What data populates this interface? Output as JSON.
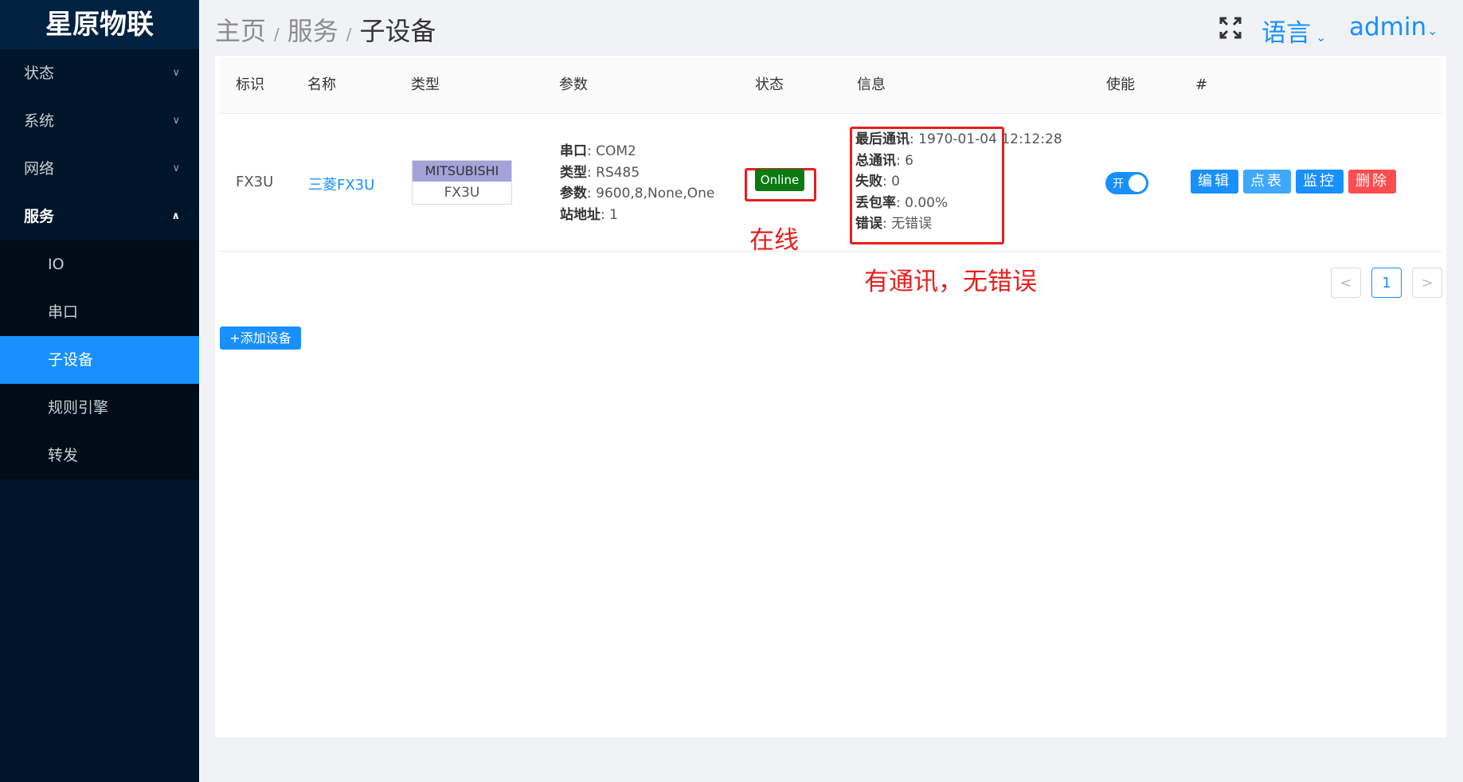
{
  "brand": "星原物联",
  "sidebar": {
    "items": [
      {
        "label": "状态"
      },
      {
        "label": "系统"
      },
      {
        "label": "网络"
      },
      {
        "label": "服务"
      }
    ],
    "sub_items": [
      {
        "label": "IO"
      },
      {
        "label": "串口"
      },
      {
        "label": "子设备"
      },
      {
        "label": "规则引擎"
      },
      {
        "label": "转发"
      }
    ]
  },
  "header": {
    "breadcrumb": [
      "主页",
      "服务",
      "子设备"
    ],
    "separator": "/",
    "language": "语言",
    "user": "admin",
    "dropdown_glyph": "⌄"
  },
  "table": {
    "columns": [
      "标识",
      "名称",
      "类型",
      "参数",
      "状态",
      "信息",
      "使能",
      "#"
    ],
    "rows": [
      {
        "id": "FX3U",
        "name": "三菱FX3U",
        "type_brand": "MITSUBISHI",
        "type_model": "FX3U",
        "params": [
          {
            "key": "串口",
            "value": ": COM2"
          },
          {
            "key": "类型",
            "value": ": RS485"
          },
          {
            "key": "参数",
            "value": ": 9600,8,None,One"
          },
          {
            "key": "站地址",
            "value": ": 1"
          }
        ],
        "status": "Online",
        "info": [
          {
            "key": "最后通讯",
            "value": ": 1970-01-04 12:12:28"
          },
          {
            "key": "总通讯",
            "value": ": 6"
          },
          {
            "key": "失败",
            "value": ": 0"
          },
          {
            "key": "丢包率",
            "value": ": 0.00%"
          },
          {
            "key": "错误",
            "value": ": 无错误"
          }
        ],
        "enabled_label": "开",
        "enabled": true,
        "actions": [
          {
            "label": "编辑",
            "color": "#1890ff"
          },
          {
            "label": "点表",
            "color": "#40a9ff"
          },
          {
            "label": "监控",
            "color": "#1890ff"
          },
          {
            "label": "删除",
            "color": "#ff4d4f"
          }
        ]
      }
    ]
  },
  "annotations": {
    "status": "在线",
    "info": "有通讯，无错误"
  },
  "pagination": {
    "prev": "<",
    "page": "1",
    "next": ">"
  },
  "add_button": "+添加设备",
  "colors": {
    "primary": "#1890ff",
    "sidebar_bg": "#001529",
    "online": "#0a7a12",
    "annotation": "#e81e1e",
    "danger": "#ff4d4f"
  }
}
